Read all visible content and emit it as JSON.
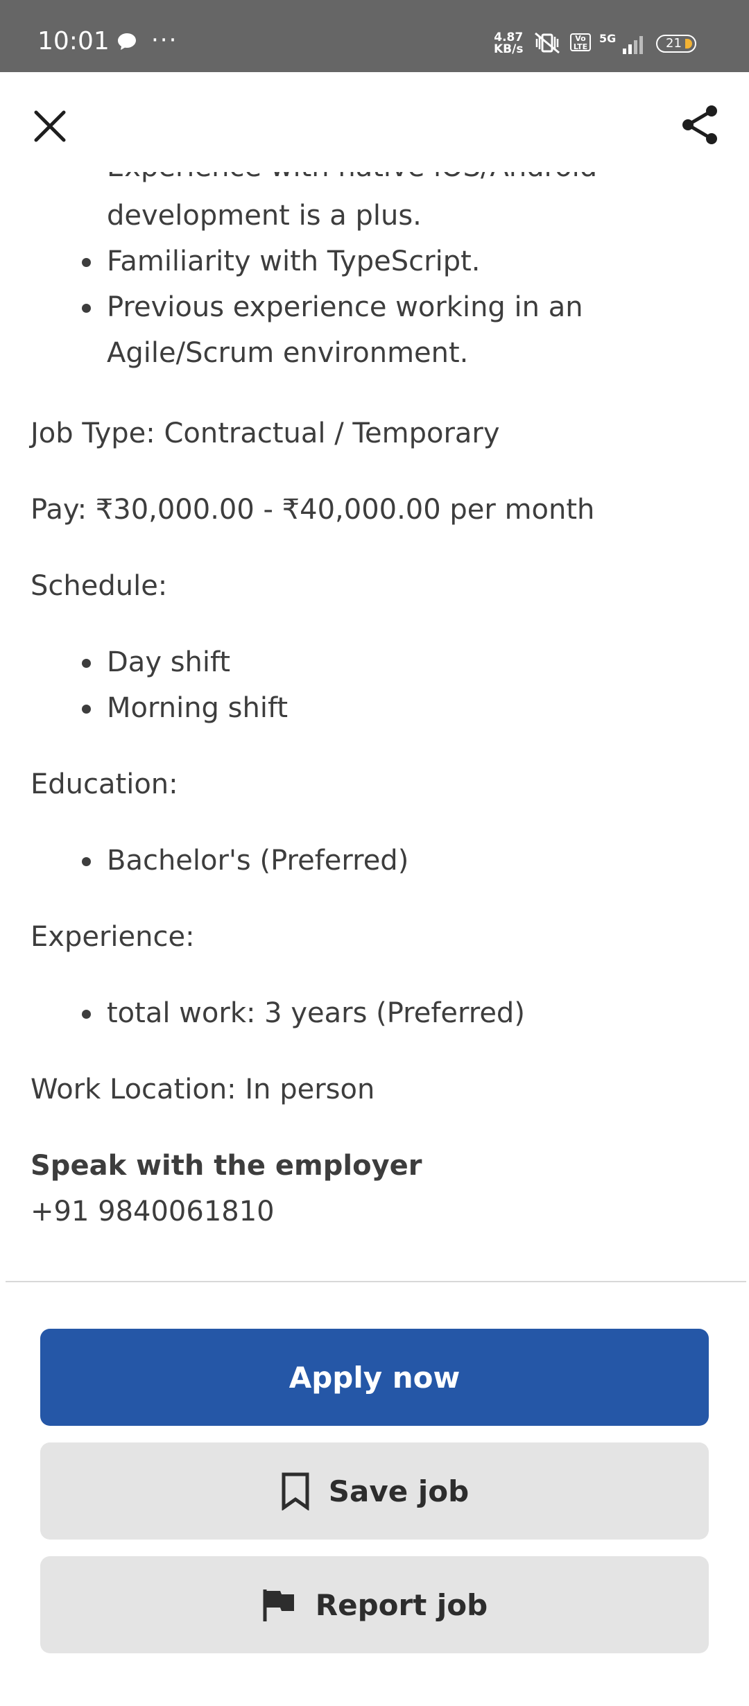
{
  "status_bar": {
    "time": "10:01",
    "speed_value": "4.87",
    "speed_unit": "KB/s",
    "volte": "Vo LTE",
    "network": "5G",
    "battery": "21"
  },
  "job": {
    "clipped_line": "Experience with native iOS/Android",
    "requirements_tail": [
      {
        "lines": [
          "development is a plus."
        ],
        "bullet": false
      },
      {
        "lines": [
          "Familiarity with TypeScript."
        ],
        "bullet": true
      },
      {
        "lines": [
          "Previous experience working in an",
          "Agile/Scrum environment."
        ],
        "bullet": true
      }
    ],
    "job_type": "Job Type: Contractual / Temporary",
    "pay": "Pay: ₹30,000.00 - ₹40,000.00 per month",
    "schedule_label": "Schedule:",
    "schedule_items": [
      "Day shift",
      "Morning shift"
    ],
    "education_label": "Education:",
    "education_items": [
      "Bachelor's (Preferred)"
    ],
    "experience_label": "Experience:",
    "experience_items": [
      "total work: 3 years (Preferred)"
    ],
    "work_location": "Work Location: In person",
    "employer_heading": "Speak with the employer",
    "employer_phone": "+91 9840061810"
  },
  "actions": {
    "apply_label": "Apply now",
    "save_label": "Save job",
    "report_label": "Report job"
  },
  "icons": {
    "close": "close-icon",
    "share": "share-icon",
    "bookmark": "bookmark-icon",
    "flag": "flag-icon"
  },
  "colors": {
    "status_bar": "#666666",
    "primary_button": "#2557a7",
    "secondary_button": "#e4e4e4",
    "body_text": "#3d3d3d"
  }
}
